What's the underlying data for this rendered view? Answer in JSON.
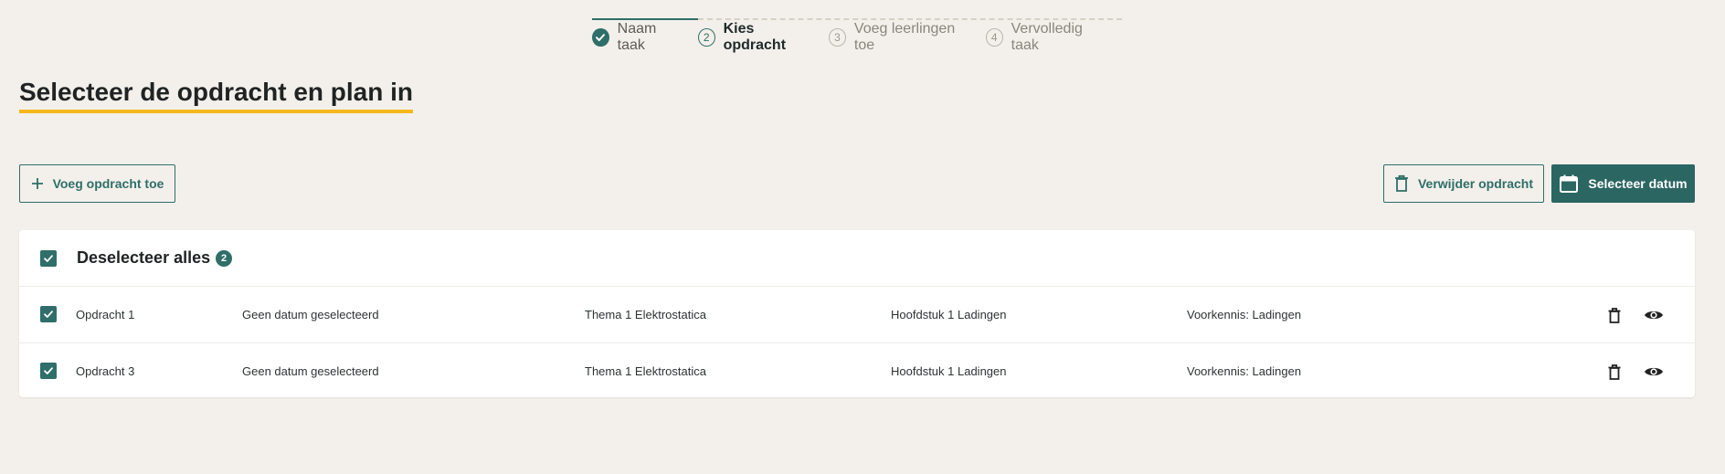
{
  "stepper": {
    "steps": [
      {
        "number": "",
        "label": "Naam taak",
        "state": "done"
      },
      {
        "number": "2",
        "label": "Kies opdracht",
        "state": "active"
      },
      {
        "number": "3",
        "label": "Voeg leerlingen toe",
        "state": "todo"
      },
      {
        "number": "4",
        "label": "Vervolledig taak",
        "state": "todo"
      }
    ]
  },
  "page": {
    "title": "Selecteer de opdracht en plan in"
  },
  "toolbar": {
    "add_label": "Voeg opdracht toe",
    "delete_label": "Verwijder opdracht",
    "date_label": "Selecteer datum"
  },
  "list": {
    "header_label": "Deselecteer alles",
    "selected_count": "2",
    "rows": [
      {
        "name": "Opdracht 1",
        "date": "Geen datum geselecteerd",
        "theme": "Thema 1 Elektrostatica",
        "chapter": "Hoofdstuk 1 Ladingen",
        "knowledge": "Voorkennis: Ladingen"
      },
      {
        "name": "Opdracht 3",
        "date": "Geen datum geselecteerd",
        "theme": "Thema 1 Elektrostatica",
        "chapter": "Hoofdstuk 1 Ladingen",
        "knowledge": "Voorkennis: Ladingen"
      }
    ]
  },
  "colors": {
    "primary": "#2f6e69",
    "accent_underline": "#f5b81c",
    "background": "#f3f0eb"
  },
  "icons": {
    "add": "plus-icon",
    "delete": "trash-icon",
    "date": "calendar-icon",
    "view": "eye-icon",
    "check": "check-icon"
  }
}
